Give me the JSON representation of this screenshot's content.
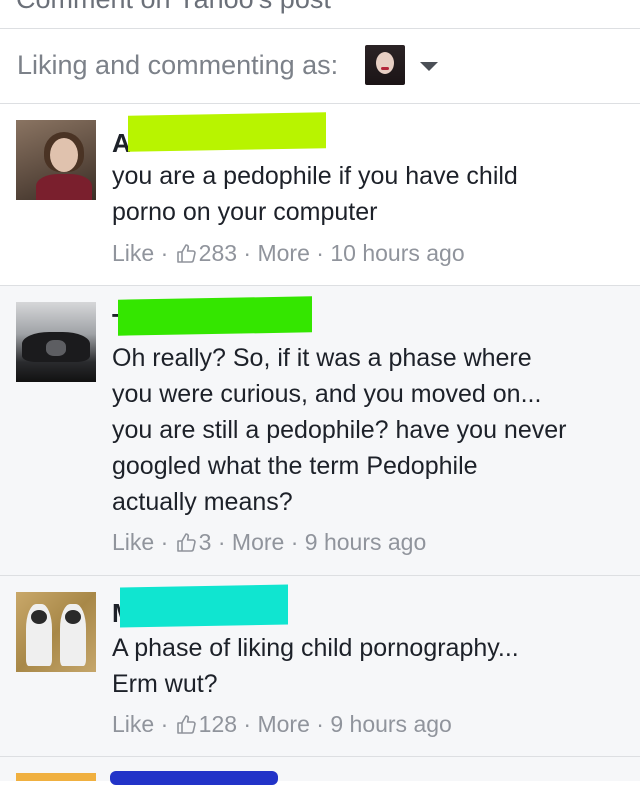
{
  "header": {
    "partial_title": "Comment on Yahoo's post"
  },
  "liking_bar": {
    "label": "Liking and commenting as:",
    "caret_icon": "dropdown-caret-icon"
  },
  "comments": [
    {
      "name_initial": "A",
      "text_lines": [
        "you are a pedophile if you have child",
        "porno on your computer"
      ],
      "like_label": "Like",
      "separator": "·",
      "like_count": "283",
      "more_label": "More",
      "timestamp": "10 hours ago",
      "redaction_color": "#b8f400"
    },
    {
      "name_initial": "T",
      "text_lines": [
        "Oh really? So, if it was a phase where",
        "you were curious, and you moved on...",
        "you are still a pedophile? have you never",
        "googled what the term Pedophile",
        "actually means?"
      ],
      "like_label": "Like",
      "separator": "·",
      "like_count": "3",
      "more_label": "More",
      "timestamp": "9 hours ago",
      "redaction_color": "#34e600"
    },
    {
      "name_initial": "M",
      "text_lines": [
        "A phase of liking child pornography...",
        "Erm wut?"
      ],
      "like_label": "Like",
      "separator": "·",
      "like_count": "128",
      "more_label": "More",
      "timestamp": "9 hours ago",
      "redaction_color": "#10e5d0"
    }
  ],
  "icons": {
    "like_thumb": "thumbs-up-icon"
  }
}
